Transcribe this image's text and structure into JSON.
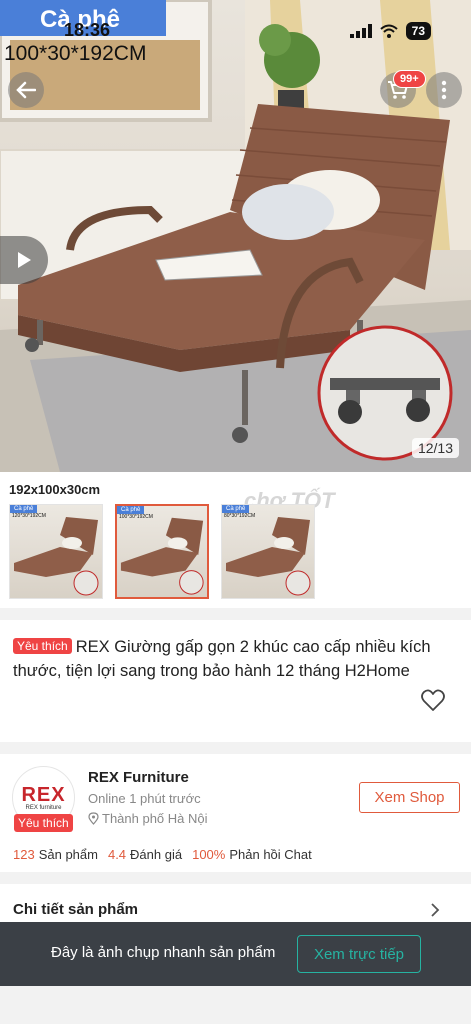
{
  "status_bar": {
    "time": "18:36",
    "battery": "73"
  },
  "hero": {
    "variant_tag": "Cà phê",
    "variant_size": "100*30*192CM",
    "cart_badge": "99+",
    "image_counter": "12/13"
  },
  "variants": {
    "selected_label": "192x100x30cm",
    "thumbnails": [
      {
        "tag": "Cà phê",
        "size": "120*30*192CM"
      },
      {
        "tag": "Cà phê",
        "size": "100*30*192CM"
      },
      {
        "tag": "Cà phê",
        "size": "80*30*192CM"
      }
    ]
  },
  "product": {
    "favorite_tag": "Yêu thích",
    "title": "REX Giường gấp gọn 2 khúc cao cấp nhiều kích thước, tiện lợi sang trong bảo hành 12 tháng H2Home"
  },
  "shop": {
    "logo_text": "REX",
    "logo_sub": "REX furniture",
    "favorite_tag": "Yêu thích",
    "name": "REX Furniture",
    "online": "Online 1 phút trước",
    "location": "Thành phố Hà Nội",
    "button": "Xem Shop",
    "stats": [
      {
        "value": "123",
        "label": "Sản phẩm"
      },
      {
        "value": "4.4",
        "label": "Đánh giá"
      },
      {
        "value": "100%",
        "label": "Phản hồi Chat"
      }
    ]
  },
  "details": {
    "title": "Chi tiết sản phẩm"
  },
  "snapshot": {
    "text": "Đây là ảnh chụp nhanh sản phẩm",
    "button": "Xem trực tiếp"
  },
  "colors": {
    "accent": "#e05a3c",
    "badge": "#ef4444",
    "teal": "#26b3a2",
    "bed": "#8a5a45",
    "tag_blue": "#4a7fd8"
  },
  "icons": {
    "back": "arrow-left-icon",
    "cart": "cart-icon",
    "more": "more-vertical-icon",
    "play": "play-icon",
    "heart": "heart-icon",
    "location": "location-pin-icon",
    "chevron": "chevron-right-icon"
  }
}
